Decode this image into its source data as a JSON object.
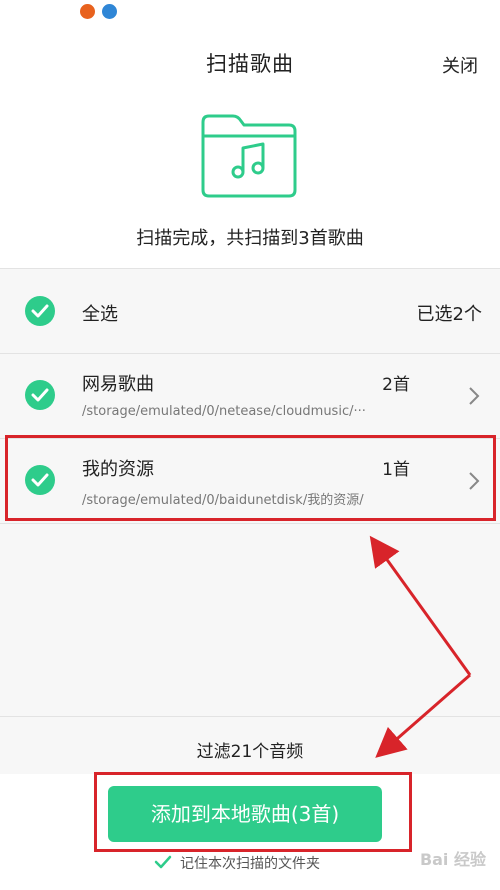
{
  "header": {
    "title": "扫描歌曲",
    "close_label": "关闭"
  },
  "scan_status": "扫描完成，共扫描到3首歌曲",
  "select_all": {
    "label": "全选",
    "selected_count": "已选2个"
  },
  "folders": [
    {
      "name": "网易歌曲",
      "count": "2首",
      "path": "/storage/emulated/0/netease/cloudmusic/···"
    },
    {
      "name": "我的资源",
      "count": "1首",
      "path": "/storage/emulated/0/baidunetdisk/我的资源/"
    }
  ],
  "filter_text": "过滤21个音频",
  "add_button_label": "添加到本地歌曲(3首)",
  "remember_label": "记住本次扫描的文件夹",
  "watermark": "Bai 经验",
  "colors": {
    "accent": "#2ecc8b",
    "annotation": "#d8242a"
  },
  "icons": {
    "folder": "music-folder-icon",
    "check": "check-circle-icon",
    "chevron": "chevron-right-icon"
  }
}
